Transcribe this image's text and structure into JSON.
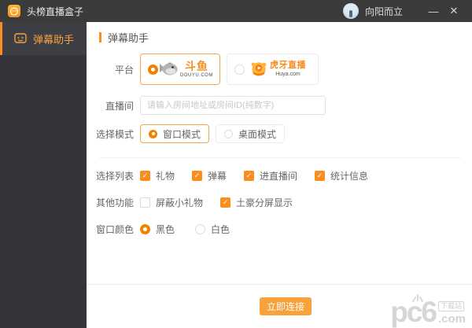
{
  "titlebar": {
    "app_title": "头榜直播盒子",
    "username": "向阳而立"
  },
  "window_controls": {
    "minimize": "—",
    "close": "✕"
  },
  "sidebar": {
    "items": [
      {
        "label": "弹幕助手",
        "active": true
      }
    ]
  },
  "page": {
    "title": "弹幕助手"
  },
  "form": {
    "platform": {
      "label": "平台",
      "options": [
        {
          "name": "斗鱼",
          "domain": "DOUYU.COM",
          "selected": true
        },
        {
          "name": "虎牙直播",
          "domain": "Huya.com",
          "selected": false
        }
      ]
    },
    "room": {
      "label": "直播间",
      "value": "",
      "placeholder": "请输入房间地址或房间ID(纯数字)"
    },
    "mode": {
      "label": "选择模式",
      "options": [
        {
          "label": "窗口模式",
          "selected": true
        },
        {
          "label": "桌面模式",
          "selected": false
        }
      ]
    },
    "list": {
      "label": "选择列表",
      "options": [
        {
          "label": "礼物",
          "checked": true
        },
        {
          "label": "弹幕",
          "checked": true
        },
        {
          "label": "进直播间",
          "checked": true
        },
        {
          "label": "统计信息",
          "checked": true
        }
      ]
    },
    "other": {
      "label": "其他功能",
      "options": [
        {
          "label": "屏蔽小礼物",
          "checked": false
        },
        {
          "label": "土豪分屏显示",
          "checked": true
        }
      ]
    },
    "color": {
      "label": "窗口颜色",
      "options": [
        {
          "label": "黑色",
          "selected": true
        },
        {
          "label": "白色",
          "selected": false
        }
      ]
    }
  },
  "footer": {
    "connect_label": "立即连接"
  },
  "watermark": {
    "name": "pc6",
    "com": ".com",
    "badge": "下载站"
  },
  "icons": {
    "check": "✓"
  },
  "colors": {
    "accent_orange": "#f98d1f",
    "button_orange": "#f9a13a",
    "selected_border": "#f2a54e",
    "titlebar_bg": "#3b3b3b",
    "sidebar_bg": "#34343a",
    "sidebar_item_bg": "#3e3e45"
  }
}
